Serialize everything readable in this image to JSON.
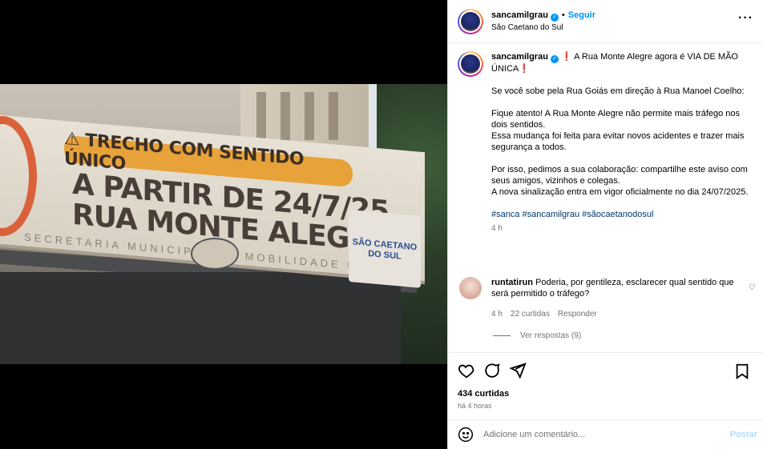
{
  "header": {
    "username": "sancamilgrau",
    "verified": true,
    "follow_label": "Seguir",
    "location": "São Caetano do Sul",
    "more_icon": "more-horizontal-icon"
  },
  "media": {
    "banner": {
      "strip": "⚠ TRECHO COM SENTIDO ÚNICO",
      "line1": "A PARTIR DE 24/7/25",
      "line2": "RUA MONTE ALEGRE",
      "sub": "SECRETARIA MUNICIPAL DE MOBILIDADE URBANA",
      "seal": "SÃO CAETANO DO SUL"
    }
  },
  "caption": {
    "username": "sancamilgrau",
    "excl": "❗",
    "title": " A Rua Monte Alegre agora é VIA DE MÃO ÚNICA",
    "excl_end": "❗",
    "p1": "Se você sobe pela Rua Goiás em direção à Rua Manoel Coelho:",
    "p2": "Fique atento! A Rua Monte Alegre não permite mais tráfego nos dois sentidos.\nEssa mudança foi feita para evitar novos acidentes e trazer mais segurança a todos.",
    "p3": "Por isso, pedimos a sua colaboração: compartilhe este aviso com seus amigos, vizinhos e colegas.\nA nova sinalização entra em vigor oficialmente no dia 24/07/2025.",
    "hashtags": "#sanca #sancamilgrau #sãocaetanodosul",
    "age": "4 h"
  },
  "comment": {
    "username": "runtatirun",
    "text": " Poderia, por gentileza, esclarecer qual sentido que será permitido o tráfego?",
    "age": "4 h",
    "likes": "22 curtidas",
    "reply_label": "Responder",
    "view_replies": "Ver respostas (9)"
  },
  "actions": {
    "likes": "434 curtidas",
    "time": "há 4 horas"
  },
  "add_comment": {
    "placeholder": "Adicione um comentário...",
    "post_label": "Postar"
  }
}
